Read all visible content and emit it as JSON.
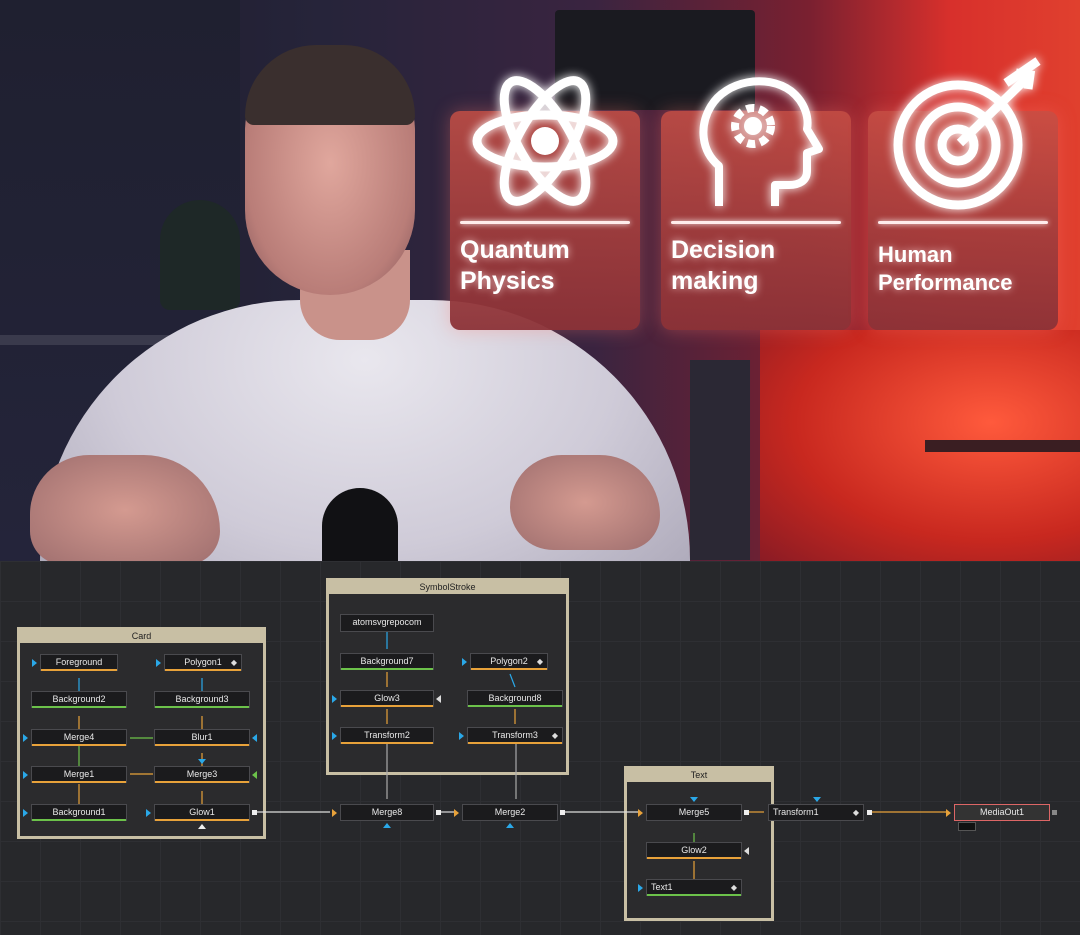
{
  "viewer": {
    "cards": [
      {
        "icon": "atom-icon",
        "line1": "Quantum",
        "line2": "Physics"
      },
      {
        "icon": "head-gear-icon",
        "line1": "Decision",
        "line2": "making"
      },
      {
        "icon": "target-arrow-icon",
        "line1": "Human",
        "line2": "Performance"
      }
    ]
  },
  "node_editor": {
    "groups": {
      "card": "Card",
      "symbolstroke": "SymbolStroke",
      "text": "Text"
    },
    "nodes": {
      "foreground": "Foreground",
      "polygon1": "Polygon1",
      "background2": "Background2",
      "background3": "Background3",
      "merge4": "Merge4",
      "blur1": "Blur1",
      "merge1": "Merge1",
      "merge3": "Merge3",
      "background1": "Background1",
      "glow1": "Glow1",
      "atomsvgrepocom": "atomsvgrepocom",
      "background7": "Background7",
      "polygon2": "Polygon2",
      "glow3": "Glow3",
      "background8": "Background8",
      "transform2": "Transform2",
      "transform3": "Transform3",
      "merge8": "Merge8",
      "merge2": "Merge2",
      "merge5": "Merge5",
      "transform1": "Transform1",
      "glow2": "Glow2",
      "text1": "Text1",
      "mediaout1": "MediaOut1"
    },
    "colors": {
      "output_orange": "#e8a23a",
      "mask_green": "#6cc24a",
      "input_blue": "#2aa8e8",
      "group_frame": "#c8bfa4",
      "mediaout_border": "#d66"
    }
  }
}
